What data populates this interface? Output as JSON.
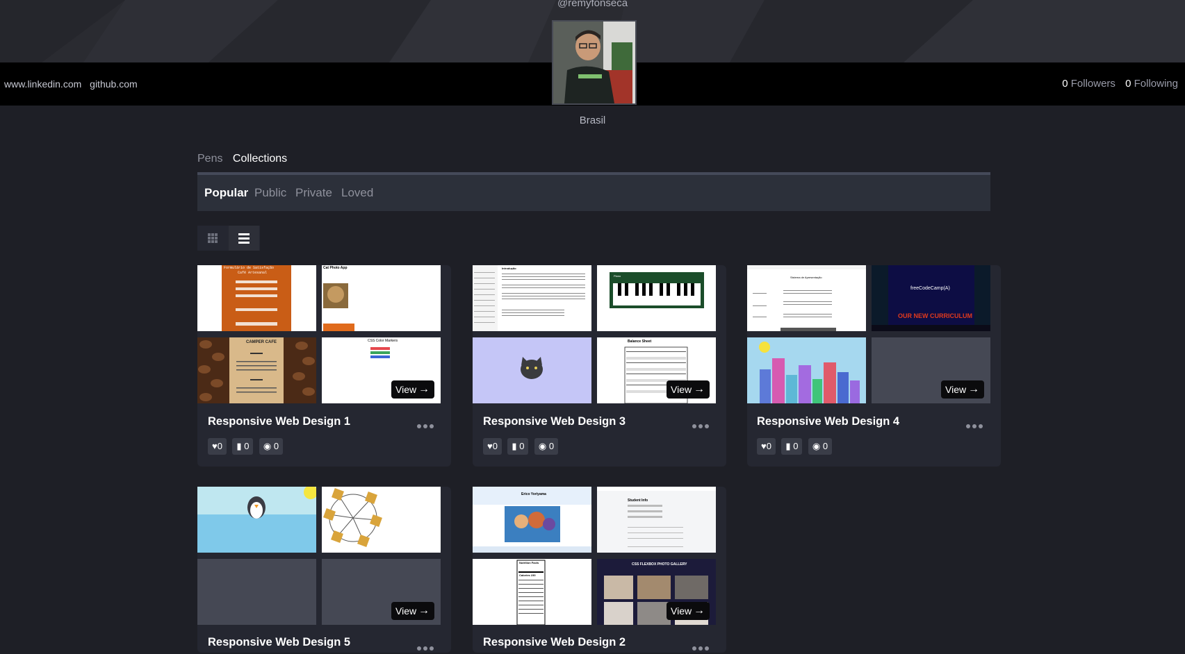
{
  "profile": {
    "handle": "@remyfonseca",
    "country": "Brasil",
    "links": [
      "www.linkedin.com",
      "github.com"
    ],
    "followers_count": "0",
    "followers_label": "Followers",
    "following_count": "0",
    "following_label": "Following"
  },
  "tabs": [
    {
      "label": "Pens",
      "active": false
    },
    {
      "label": "Collections",
      "active": true
    }
  ],
  "filters": [
    {
      "label": "Popular",
      "active": true
    },
    {
      "label": "Public",
      "active": false
    },
    {
      "label": "Private",
      "active": false
    },
    {
      "label": "Loved",
      "active": false
    }
  ],
  "view_toggle": {
    "grid_icon": "grid-icon",
    "list_icon": "list-icon",
    "active": "list"
  },
  "view_label": "View",
  "collections": [
    {
      "title": "Responsive Web Design 1",
      "likes": "0",
      "comments": "0",
      "views": "0"
    },
    {
      "title": "Responsive Web Design 3",
      "likes": "0",
      "comments": "0",
      "views": "0"
    },
    {
      "title": "Responsive Web Design 4",
      "likes": "0",
      "comments": "0",
      "views": "0"
    },
    {
      "title": "Responsive Web Design 5",
      "likes": "",
      "comments": "",
      "views": ""
    },
    {
      "title": "Responsive Web Design 2",
      "likes": "",
      "comments": "",
      "views": ""
    }
  ],
  "thumb_texts": {
    "c1_t1": "Formulário de Satisfação",
    "c1_t1b": "Café Artesanal",
    "c1_t2": "Cat Photo App",
    "c1_t3": "CAMPER CAFE",
    "c1_t4": "CSS Color Markers",
    "c2_t1": "Introdução",
    "c2_t2": "Piano",
    "c2_t4": "Balance Sheet",
    "c3_t1": "Sistema de Apresentação",
    "c3_t2": "freeCodeCamp(A)",
    "c3_t2b": "OUR NEW CURRICULUM",
    "c5_t1": "Erico Yoriyama",
    "c5_t2": "Student Info",
    "c5_t3": "Nutrition Facts",
    "c5_t3b": "Calories 230",
    "c5_t4": "CSS FLEXBOX PHOTO GALLERY"
  },
  "colors": {
    "background": "#1e1f26",
    "card": "#252731",
    "profile_bar": "#000000",
    "filter_bar": "#2c303a",
    "active_text": "#ffffff",
    "muted_text": "#8f919c"
  }
}
